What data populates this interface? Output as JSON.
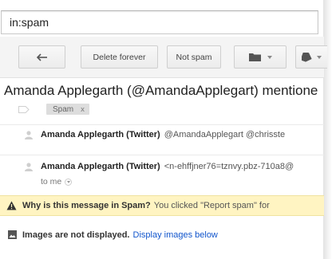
{
  "search": {
    "value": "in:spam"
  },
  "toolbar": {
    "back_label": "",
    "delete_forever_label": "Delete forever",
    "not_spam_label": "Not spam"
  },
  "subject": "Amanda Applegarth (@AmandaApplegart) mentione",
  "labels": [
    {
      "name": "Spam",
      "remove": "x"
    }
  ],
  "messages": [
    {
      "sender": "Amanda Applegarth (Twitter)",
      "snippet": "@AmandaApplegart @chrisste"
    },
    {
      "sender": "Amanda Applegarth (Twitter)",
      "snippet": "<n-ehffjner76=tznvy.pbz-710a8@",
      "to": "to me"
    }
  ],
  "spam_warning": {
    "bold": "Why is this message in Spam?",
    "text": "You clicked \"Report spam\" for"
  },
  "images_notice": {
    "bold": "Images are not displayed.",
    "link": "Display images below"
  },
  "colors": {
    "toolbar_bg": "#f4f4f4",
    "warning_bg": "#fff4c2",
    "link": "#1155cc"
  }
}
